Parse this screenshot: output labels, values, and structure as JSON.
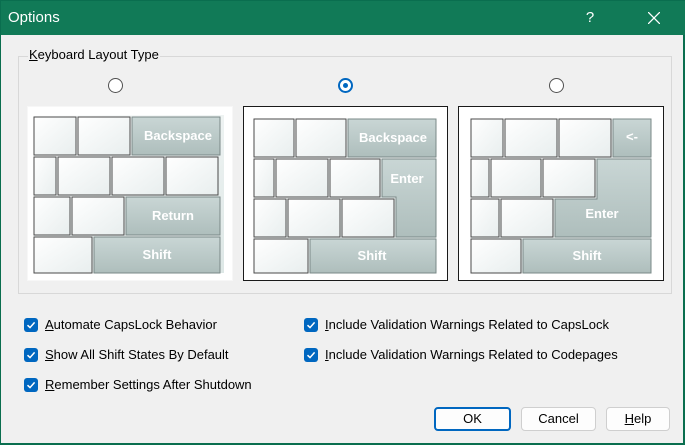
{
  "window": {
    "title": "Options",
    "help_glyph": "?"
  },
  "group": {
    "label": "Keyboard Layout Type",
    "mnemonic": "K",
    "rest": "eyboard Layout Type"
  },
  "layouts": [
    {
      "checked": false,
      "keys": [
        "Backspace",
        "Return",
        "Shift"
      ]
    },
    {
      "checked": true,
      "keys": [
        "Backspace",
        "Enter",
        "Shift"
      ]
    },
    {
      "checked": false,
      "keys": [
        "<-",
        "Enter",
        "Shift"
      ]
    }
  ],
  "options": [
    {
      "label": "Automate CapsLock Behavior",
      "mnemonic": "A",
      "rest": "utomate CapsLock Behavior",
      "checked": true
    },
    {
      "label": "Show All Shift States By Default",
      "mnemonic": "S",
      "rest": "how All Shift States By Default",
      "checked": true
    },
    {
      "label": "Remember Settings After Shutdown",
      "mnemonic": "R",
      "rest": "emember Settings After Shutdown",
      "checked": true
    },
    {
      "label": "Include Validation Warnings Related to CapsLock",
      "mnemonic": "I",
      "rest": "nclude Validation Warnings Related to CapsLock",
      "checked": true
    },
    {
      "label": "Include Validation Warnings Related to Codepages",
      "mnemonic": "I",
      "rest": "nclude Validation Warnings Related to Codepages",
      "checked": true
    }
  ],
  "buttons": {
    "ok": "OK",
    "cancel": "Cancel",
    "help": {
      "label": "Help",
      "mnemonic": "H",
      "rest": "elp"
    }
  },
  "colors": {
    "title_bar": "#117a57",
    "accent": "#0067c0"
  }
}
